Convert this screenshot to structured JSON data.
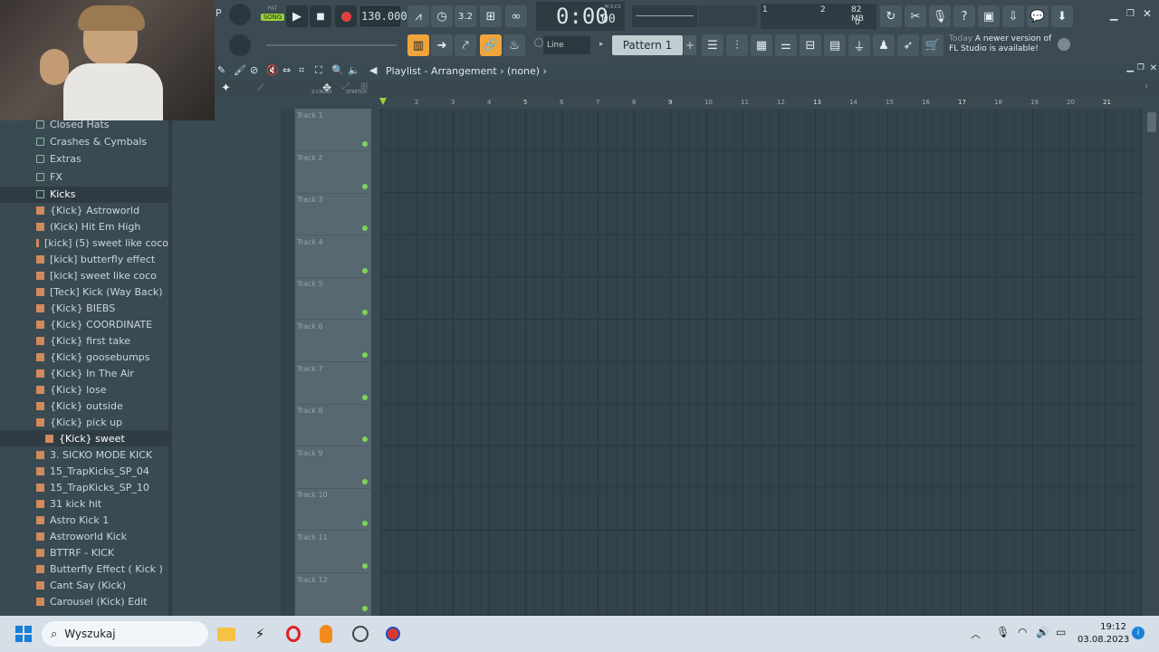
{
  "toolbar": {
    "pat_label": "PAT",
    "song_label": "SONG",
    "tempo": "130.000",
    "time": "0:00",
    "time_small": "00",
    "time_unit": "M:S:CS",
    "cpu_num": "1",
    "poly_num": "2",
    "memory": "82 MB",
    "mem_zero": "0",
    "snap_mode": "Line",
    "pattern": "Pattern 1",
    "news_today": "Today",
    "news_text1": "A newer version of",
    "news_text2": "FL Studio is available!"
  },
  "playlist": {
    "title": "Playlist - Arrangement › (none) ›",
    "zcross": "Z-CROSS",
    "stretch": "STRETCH",
    "bars": [
      "2",
      "3",
      "4",
      "5",
      "6",
      "7",
      "8",
      "9",
      "10",
      "11",
      "12",
      "13",
      "14",
      "15",
      "16",
      "17",
      "18",
      "19",
      "20",
      "21"
    ],
    "tracks": [
      "Track 1",
      "Track 2",
      "Track 3",
      "Track 4",
      "Track 5",
      "Track 6",
      "Track 7",
      "Track 8",
      "Track 9",
      "Track 10",
      "Track 11",
      "Track 12"
    ]
  },
  "browser": {
    "folders": [
      "Closed Hats",
      "Crashes & Cymbals",
      "Extras",
      "FX",
      "Kicks"
    ],
    "files": [
      "{Kick} Astroworld",
      "(Kick) Hit Em High",
      "[kick] (5) sweet like coco",
      "[kick] butterfly effect",
      "[kick] sweet like coco",
      "[Teck] Kick (Way Back)",
      "{Kick} BIEBS",
      "{Kick} COORDINATE",
      "{Kick} first take",
      "{Kick} goosebumps",
      "{Kick} In The Air",
      "{Kick} lose",
      "{Kick} outside",
      "{Kick} pick up",
      "{Kick} sweet",
      "3. SICKO MODE KICK",
      "15_TrapKicks_SP_04",
      "15_TrapKicks_SP_10",
      "31 kick hit",
      "Astro Kick 1",
      "Astroworld Kick",
      "BTTRF - KICK",
      "Butterfly Effect ( Kick )",
      "Cant Say (Kick)",
      "Carousel (Kick) Edit"
    ]
  },
  "taskbar": {
    "search_placeholder": "Wyszukaj",
    "time": "19:12",
    "date": "03.08.2023"
  },
  "colors": {
    "accent_orange": "#f0a43a",
    "led_green": "#7ed35a",
    "record_red": "#e04040"
  }
}
